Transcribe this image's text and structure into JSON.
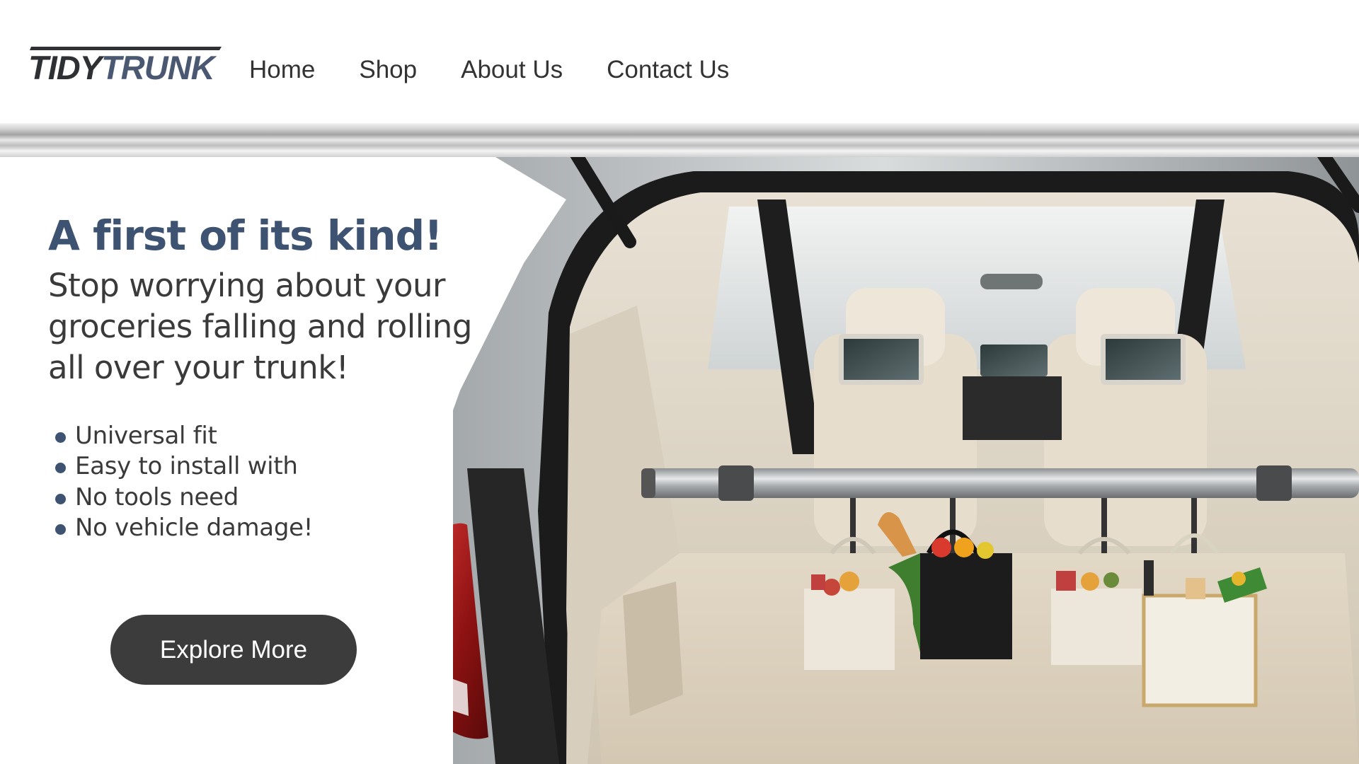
{
  "brand": {
    "logo_word1": "TIDY",
    "logo_word2": "TRUNK"
  },
  "nav": {
    "items": [
      {
        "label": "Home"
      },
      {
        "label": "Shop"
      },
      {
        "label": "About Us"
      },
      {
        "label": "Contact Us"
      }
    ]
  },
  "hero": {
    "headline": "A first of its kind!",
    "subhead_lines": [
      "Stop worrying about your",
      "groceries falling and rolling",
      "all over your trunk!"
    ],
    "features": [
      "Universal fit",
      "Easy to install with",
      "No tools need",
      "No vehicle damage!"
    ],
    "cta_label": "Explore More",
    "image_description_icon": "car-trunk-with-grocery-bags-photo"
  },
  "colors": {
    "accent": "#3e5272",
    "cta_bg": "#3d3c3d",
    "text": "#3a3a3a",
    "background": "#ffffff"
  }
}
